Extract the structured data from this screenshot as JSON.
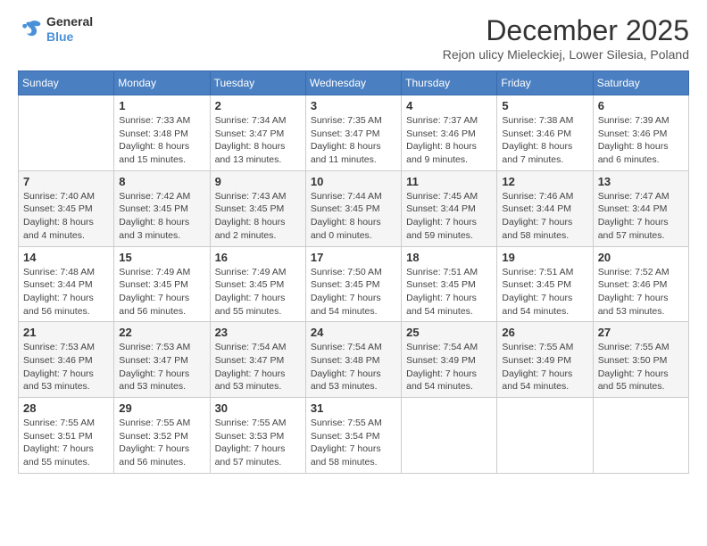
{
  "header": {
    "logo": {
      "general": "General",
      "blue": "Blue"
    },
    "title": "December 2025",
    "subtitle": "Rejon ulicy Mieleckiej, Lower Silesia, Poland"
  },
  "weekdays": [
    "Sunday",
    "Monday",
    "Tuesday",
    "Wednesday",
    "Thursday",
    "Friday",
    "Saturday"
  ],
  "weeks": [
    [
      {
        "day": null,
        "info": null
      },
      {
        "day": "1",
        "info": "Sunrise: 7:33 AM\nSunset: 3:48 PM\nDaylight: 8 hours\nand 15 minutes."
      },
      {
        "day": "2",
        "info": "Sunrise: 7:34 AM\nSunset: 3:47 PM\nDaylight: 8 hours\nand 13 minutes."
      },
      {
        "day": "3",
        "info": "Sunrise: 7:35 AM\nSunset: 3:47 PM\nDaylight: 8 hours\nand 11 minutes."
      },
      {
        "day": "4",
        "info": "Sunrise: 7:37 AM\nSunset: 3:46 PM\nDaylight: 8 hours\nand 9 minutes."
      },
      {
        "day": "5",
        "info": "Sunrise: 7:38 AM\nSunset: 3:46 PM\nDaylight: 8 hours\nand 7 minutes."
      },
      {
        "day": "6",
        "info": "Sunrise: 7:39 AM\nSunset: 3:46 PM\nDaylight: 8 hours\nand 6 minutes."
      }
    ],
    [
      {
        "day": "7",
        "info": "Sunrise: 7:40 AM\nSunset: 3:45 PM\nDaylight: 8 hours\nand 4 minutes."
      },
      {
        "day": "8",
        "info": "Sunrise: 7:42 AM\nSunset: 3:45 PM\nDaylight: 8 hours\nand 3 minutes."
      },
      {
        "day": "9",
        "info": "Sunrise: 7:43 AM\nSunset: 3:45 PM\nDaylight: 8 hours\nand 2 minutes."
      },
      {
        "day": "10",
        "info": "Sunrise: 7:44 AM\nSunset: 3:45 PM\nDaylight: 8 hours\nand 0 minutes."
      },
      {
        "day": "11",
        "info": "Sunrise: 7:45 AM\nSunset: 3:44 PM\nDaylight: 7 hours\nand 59 minutes."
      },
      {
        "day": "12",
        "info": "Sunrise: 7:46 AM\nSunset: 3:44 PM\nDaylight: 7 hours\nand 58 minutes."
      },
      {
        "day": "13",
        "info": "Sunrise: 7:47 AM\nSunset: 3:44 PM\nDaylight: 7 hours\nand 57 minutes."
      }
    ],
    [
      {
        "day": "14",
        "info": "Sunrise: 7:48 AM\nSunset: 3:44 PM\nDaylight: 7 hours\nand 56 minutes."
      },
      {
        "day": "15",
        "info": "Sunrise: 7:49 AM\nSunset: 3:45 PM\nDaylight: 7 hours\nand 56 minutes."
      },
      {
        "day": "16",
        "info": "Sunrise: 7:49 AM\nSunset: 3:45 PM\nDaylight: 7 hours\nand 55 minutes."
      },
      {
        "day": "17",
        "info": "Sunrise: 7:50 AM\nSunset: 3:45 PM\nDaylight: 7 hours\nand 54 minutes."
      },
      {
        "day": "18",
        "info": "Sunrise: 7:51 AM\nSunset: 3:45 PM\nDaylight: 7 hours\nand 54 minutes."
      },
      {
        "day": "19",
        "info": "Sunrise: 7:51 AM\nSunset: 3:45 PM\nDaylight: 7 hours\nand 54 minutes."
      },
      {
        "day": "20",
        "info": "Sunrise: 7:52 AM\nSunset: 3:46 PM\nDaylight: 7 hours\nand 53 minutes."
      }
    ],
    [
      {
        "day": "21",
        "info": "Sunrise: 7:53 AM\nSunset: 3:46 PM\nDaylight: 7 hours\nand 53 minutes."
      },
      {
        "day": "22",
        "info": "Sunrise: 7:53 AM\nSunset: 3:47 PM\nDaylight: 7 hours\nand 53 minutes."
      },
      {
        "day": "23",
        "info": "Sunrise: 7:54 AM\nSunset: 3:47 PM\nDaylight: 7 hours\nand 53 minutes."
      },
      {
        "day": "24",
        "info": "Sunrise: 7:54 AM\nSunset: 3:48 PM\nDaylight: 7 hours\nand 53 minutes."
      },
      {
        "day": "25",
        "info": "Sunrise: 7:54 AM\nSunset: 3:49 PM\nDaylight: 7 hours\nand 54 minutes."
      },
      {
        "day": "26",
        "info": "Sunrise: 7:55 AM\nSunset: 3:49 PM\nDaylight: 7 hours\nand 54 minutes."
      },
      {
        "day": "27",
        "info": "Sunrise: 7:55 AM\nSunset: 3:50 PM\nDaylight: 7 hours\nand 55 minutes."
      }
    ],
    [
      {
        "day": "28",
        "info": "Sunrise: 7:55 AM\nSunset: 3:51 PM\nDaylight: 7 hours\nand 55 minutes."
      },
      {
        "day": "29",
        "info": "Sunrise: 7:55 AM\nSunset: 3:52 PM\nDaylight: 7 hours\nand 56 minutes."
      },
      {
        "day": "30",
        "info": "Sunrise: 7:55 AM\nSunset: 3:53 PM\nDaylight: 7 hours\nand 57 minutes."
      },
      {
        "day": "31",
        "info": "Sunrise: 7:55 AM\nSunset: 3:54 PM\nDaylight: 7 hours\nand 58 minutes."
      },
      {
        "day": null,
        "info": null
      },
      {
        "day": null,
        "info": null
      },
      {
        "day": null,
        "info": null
      }
    ]
  ]
}
